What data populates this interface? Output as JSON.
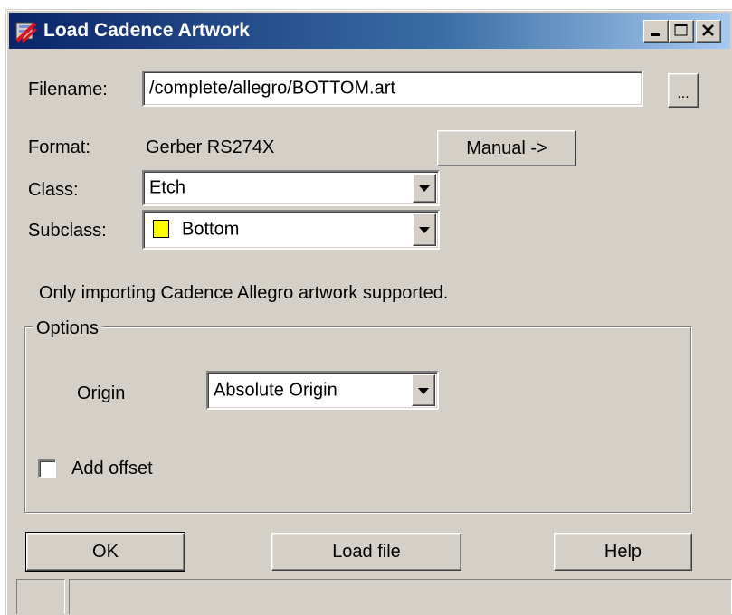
{
  "window": {
    "title": "Load Cadence Artwork",
    "icon": "cadence-app-icon",
    "controls": [
      "minimize-icon",
      "maximize-icon",
      "close-icon"
    ]
  },
  "filename": {
    "label": "Filename:",
    "value": "/complete/allegro/BOTTOM.art",
    "browse_label": "..."
  },
  "format": {
    "label": "Format:",
    "value": "Gerber RS274X",
    "manual_button": "Manual ->"
  },
  "class": {
    "label": "Class:",
    "value": "Etch"
  },
  "subclass": {
    "label": "Subclass:",
    "value": "Bottom",
    "swatch_color": "#ffff00"
  },
  "info_text": "Only importing Cadence Allegro artwork supported.",
  "options": {
    "title": "Options",
    "origin_label": "Origin",
    "origin_value": "Absolute Origin",
    "add_offset_label": "Add offset",
    "add_offset_checked": false
  },
  "buttons": {
    "ok": "OK",
    "load_file": "Load file",
    "help": "Help"
  },
  "colors": {
    "dialog_bg": "#d4d0c8",
    "title_start": "#0a246a",
    "title_end": "#a6caf0"
  }
}
